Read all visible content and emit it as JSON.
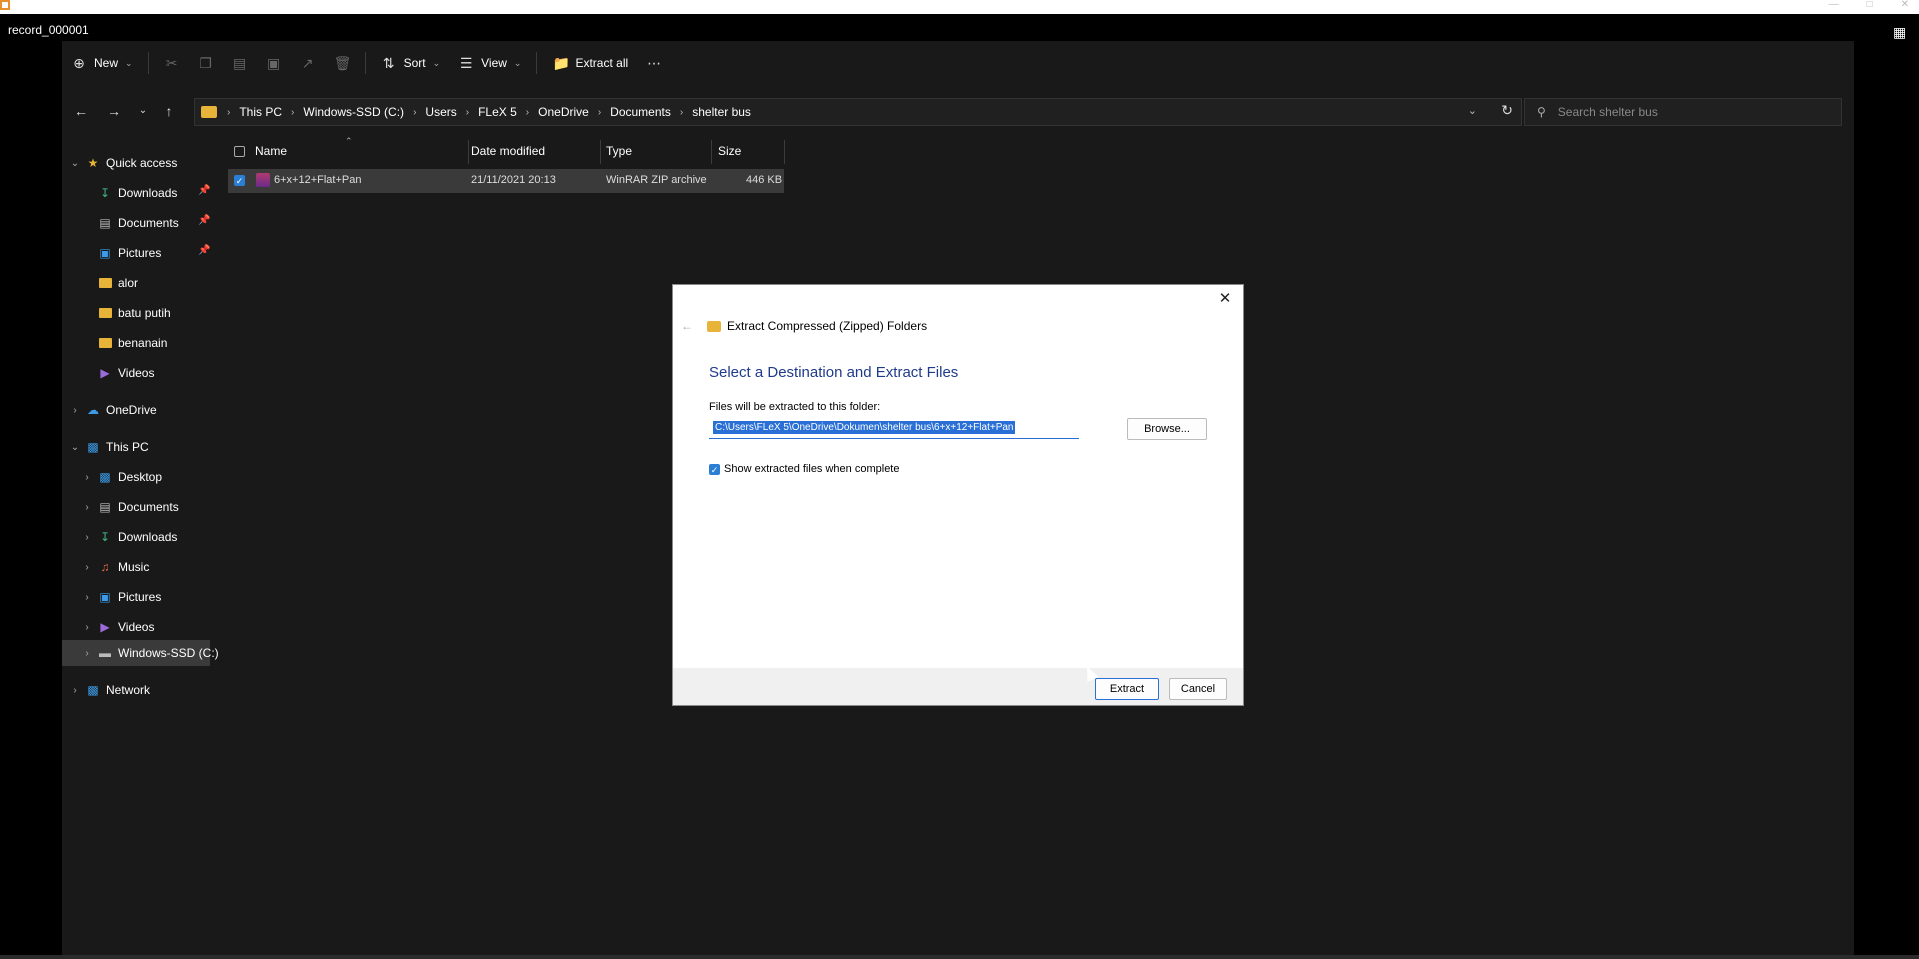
{
  "recording": {
    "title": "record_000001"
  },
  "colors": {
    "accent": "#2a6fd5",
    "folder": "#e8b339",
    "dialog_heading": "#1f3a8a"
  },
  "toolbar": {
    "new_label": "New",
    "sort_label": "Sort",
    "view_label": "View",
    "extract_all_label": "Extract all"
  },
  "address": {
    "crumbs": [
      "This PC",
      "Windows-SSD (C:)",
      "Users",
      "FLeX 5",
      "OneDrive",
      "Documents",
      "shelter bus"
    ]
  },
  "search": {
    "placeholder": "Search shelter bus"
  },
  "sidebar": {
    "quick_access": "Quick access",
    "qa_items": [
      "Downloads",
      "Documents",
      "Pictures",
      "alor",
      "batu putih",
      "benanain",
      "Videos"
    ],
    "onedrive": "OneDrive",
    "this_pc": "This PC",
    "pc_items": [
      "Desktop",
      "Documents",
      "Downloads",
      "Music",
      "Pictures",
      "Videos",
      "Windows-SSD (C:)"
    ],
    "network": "Network"
  },
  "file_list": {
    "columns": [
      "Name",
      "Date modified",
      "Type",
      "Size"
    ],
    "rows": [
      {
        "name": "6+x+12+Flat+Pan",
        "date_modified": "21/11/2021 20:13",
        "type": "WinRAR ZIP archive",
        "size": "446 KB",
        "selected": true
      }
    ]
  },
  "dialog": {
    "title": "Extract Compressed (Zipped) Folders",
    "heading": "Select a Destination and Extract Files",
    "dest_label": "Files will be extracted to this folder:",
    "dest_path": "C:\\Users\\FLeX 5\\OneDrive\\Dokumen\\shelter bus\\6+x+12+Flat+Pan",
    "browse_label": "Browse...",
    "show_files_label": "Show extracted files when complete",
    "show_files_checked": true,
    "extract_label": "Extract",
    "cancel_label": "Cancel"
  }
}
